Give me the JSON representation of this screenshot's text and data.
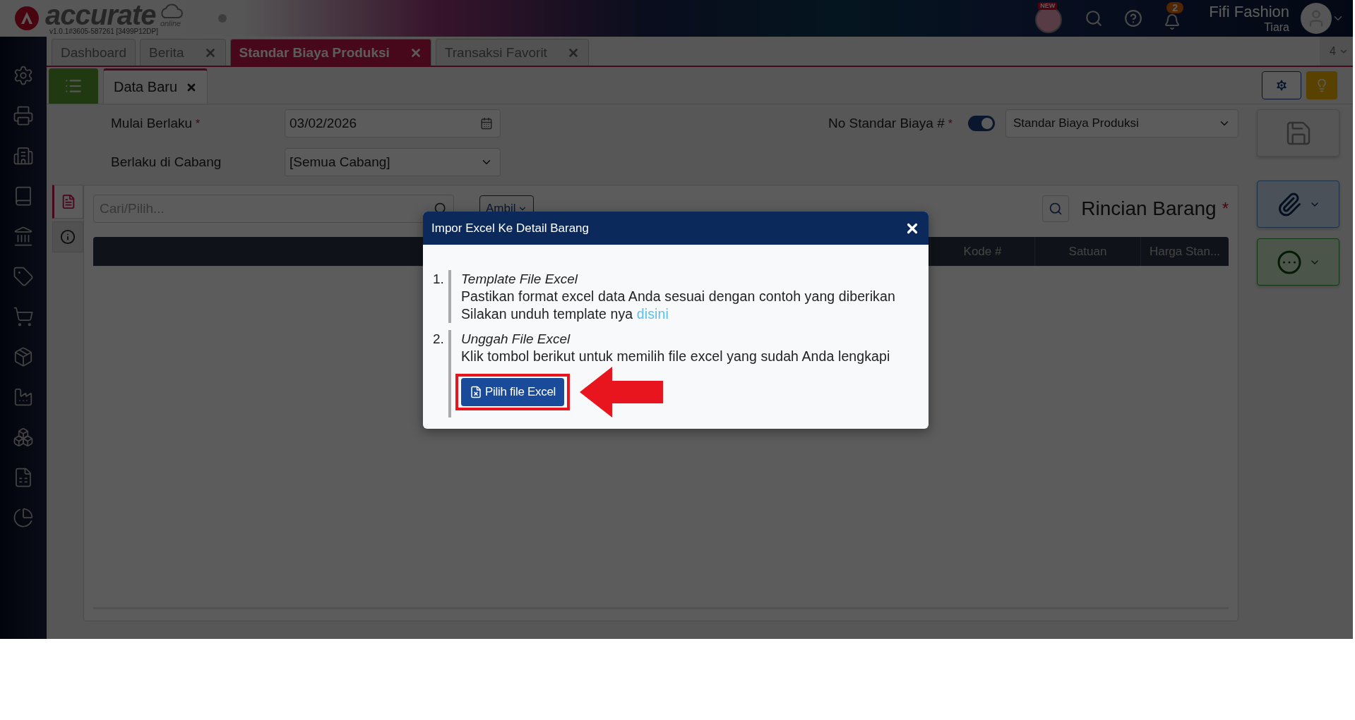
{
  "header": {
    "logo": "accurate",
    "logo_sub": "online",
    "version": "v1.0.1#3605-587261 [3499P12DP]",
    "new_badge": "NEW",
    "notification_count": "2",
    "company": "Fifi Fashion",
    "user": "Tiara"
  },
  "tabs": [
    {
      "label": "Dashboard",
      "closable": false,
      "selected": false
    },
    {
      "label": "Berita",
      "closable": true,
      "selected": false
    },
    {
      "label": "Standar Biaya Produksi",
      "closable": true,
      "selected": true
    },
    {
      "label": "Transaksi Favorit",
      "closable": true,
      "selected": false
    }
  ],
  "tab_count": "4",
  "subtabs": [
    {
      "label": "Data Baru",
      "selected": true
    }
  ],
  "form": {
    "start_label": "Mulai Berlaku",
    "required_mark": "*",
    "start_value": "03/02/2026",
    "branch_label": "Berlaku di Cabang",
    "branch_value": "[Semua Cabang]",
    "number_label": "No Standar Biaya #",
    "auto_number": true,
    "number_type": "Standar Biaya Produksi"
  },
  "side_tabs": [
    {
      "kind": "document",
      "selected": true
    },
    {
      "kind": "info",
      "selected": false
    }
  ],
  "detail": {
    "search_placeholder": "Cari/Pilih...",
    "take_button": "Ambil",
    "title": "Rincian Barang",
    "required_mark": "*",
    "columns": [
      "Kode #",
      "Satuan",
      "Harga Stan..."
    ]
  },
  "dialog": {
    "title": "Impor Excel Ke Detail Barang",
    "steps": [
      {
        "number": "1.",
        "title": "Template File Excel",
        "lines": [
          "Pastikan format excel data Anda sesuai dengan contoh yang diberikan"
        ],
        "link_prefix": "Silakan unduh template nya",
        "link": "disini"
      },
      {
        "number": "2.",
        "title": "Unggah File Excel",
        "lines": [
          "Klik tombol berikut untuk memilih file excel yang sudah Anda lengkapi"
        ],
        "button": "Pilih file Excel"
      }
    ]
  }
}
